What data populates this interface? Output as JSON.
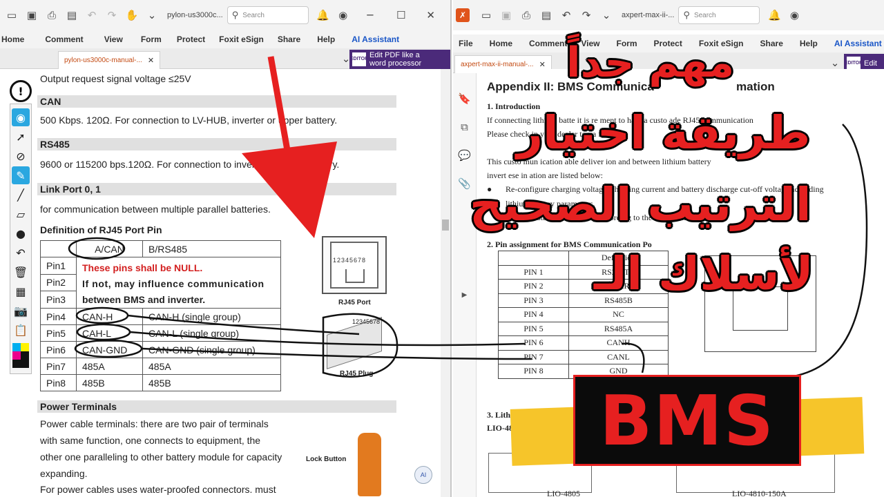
{
  "left_window": {
    "title": "pylon-us3000c...",
    "search_placeholder": "Search",
    "menu": [
      "Home",
      "Comment",
      "View",
      "Form",
      "Protect",
      "Foxit eSign",
      "Share",
      "Help",
      "AI Assistant"
    ],
    "tab_label": "pylon-us3000c-manual-...",
    "banner_line1": "Edit PDF like a",
    "banner_line2": "word processor",
    "banner_logo": "EDITOR",
    "page": {
      "line_output": "Output request signal voltage ≤25V",
      "can_heading": "CAN",
      "can_text": "500 Kbps. 120Ω. For connection to LV-HUB, inverter or upper battery.",
      "rs485_heading": "RS485",
      "rs485_text": "9600 or 115200 bps.120Ω. For connection to inverter or upper battery.",
      "link_heading": "Link Port 0, 1",
      "link_text": "for communication between multiple parallel batteries.",
      "def_heading": "Definition of RJ45 Port Pin",
      "table_header": [
        "",
        "A/CAN",
        "B/RS485"
      ],
      "null_note": "These pins shall be NULL.",
      "null_note2": "If not, may influence communication",
      "null_note3": "between BMS and inverter.",
      "pins": [
        {
          "pin": "Pin1"
        },
        {
          "pin": "Pin2"
        },
        {
          "pin": "Pin3"
        },
        {
          "pin": "Pin4",
          "a": "CAN-H",
          "b": "CAN-H (single group)"
        },
        {
          "pin": "Pin5",
          "a": "CAH-L",
          "b": "CAN-L (single group)"
        },
        {
          "pin": "Pin6",
          "a": "CAN-GND",
          "b": "CAN-GND (single group)"
        },
        {
          "pin": "Pin7",
          "a": "485A",
          "b": "485A"
        },
        {
          "pin": "Pin8",
          "a": "485B",
          "b": "485B"
        }
      ],
      "rj45_port_label": "RJ45 Port",
      "rj45_plug_label": "RJ45 Plug",
      "rj45_digits": "12345678",
      "power_heading": "Power Terminals",
      "power_lines": [
        "Power cable terminals: there are two pair of terminals",
        "with same function, one connects to equipment, the",
        "other one paralleling to other battery module for capacity",
        "expanding.",
        "For power cables uses water-proofed connectors. must"
      ],
      "lock_button_label": "Lock Button"
    }
  },
  "right_window": {
    "title": "axpert-max-ii-...",
    "search_placeholder": "Search",
    "menu": [
      "File",
      "Home",
      "Comment",
      "View",
      "Form",
      "Protect",
      "Foxit eSign",
      "Share",
      "Help",
      "AI Assistant"
    ],
    "tab_label": "axpert-max-ii-manual-...",
    "banner_line1": "Edit",
    "banner_logo": "EDITOR",
    "page": {
      "appendix_title": "Appendix II: BMS Communica",
      "appendix_title_end": "mation",
      "intro_heading": "1.   Introduction",
      "intro_lines": [
        "If connecting          lithium batte         it is re           ment        to          hase a custo        ade RJ45 communication",
        "Please check         in your dealer         tegra          for det",
        "This custo            mun         ication        able deliver       ion       and           between lithium battery",
        "invert          ese      in      ation are listed below:"
      ],
      "bullet1_a": "Re-configure charging voltage, charging current and battery discharge cut-off voltage according",
      "bullet1_b": "lithium battery parameters.",
      "bullet2": "Have the        start and         charging according to the status          attery.",
      "pin_heading": "2.   Pin assignment for BMS Communication Po",
      "table_header": "Definition",
      "rows": [
        {
          "pin": "PIN 1",
          "def": "RS232TX"
        },
        {
          "pin": "PIN 2",
          "def": "RS232RX"
        },
        {
          "pin": "PIN 3",
          "def": "RS485B"
        },
        {
          "pin": "PIN 4",
          "def": "NC"
        },
        {
          "pin": "PIN 5",
          "def": "RS485A"
        },
        {
          "pin": "PIN 6",
          "def": "CANH"
        },
        {
          "pin": "PIN 7",
          "def": "CANL"
        },
        {
          "pin": "PIN 8",
          "def": "GND"
        }
      ],
      "lithium_heading": "3.   Lithium Battery",
      "lio_line": "LIO-4805/LIO-4810",
      "caption_left": "LIO-4805",
      "caption_right": "LIO-4810-150A"
    }
  },
  "overlay": {
    "ar_line1": "مهم جداً",
    "ar_line2": "طريقة اختيار",
    "ar_line3": "الترتيب الصحيح",
    "ar_line4": "لأسلاك الـ",
    "bms": "BMS"
  },
  "colors": {
    "accent_red": "#e62020",
    "highlight_yellow": "#f6c52a",
    "foxit_purple": "#4b2a7a",
    "tool_blue": "#2aa7e0"
  }
}
